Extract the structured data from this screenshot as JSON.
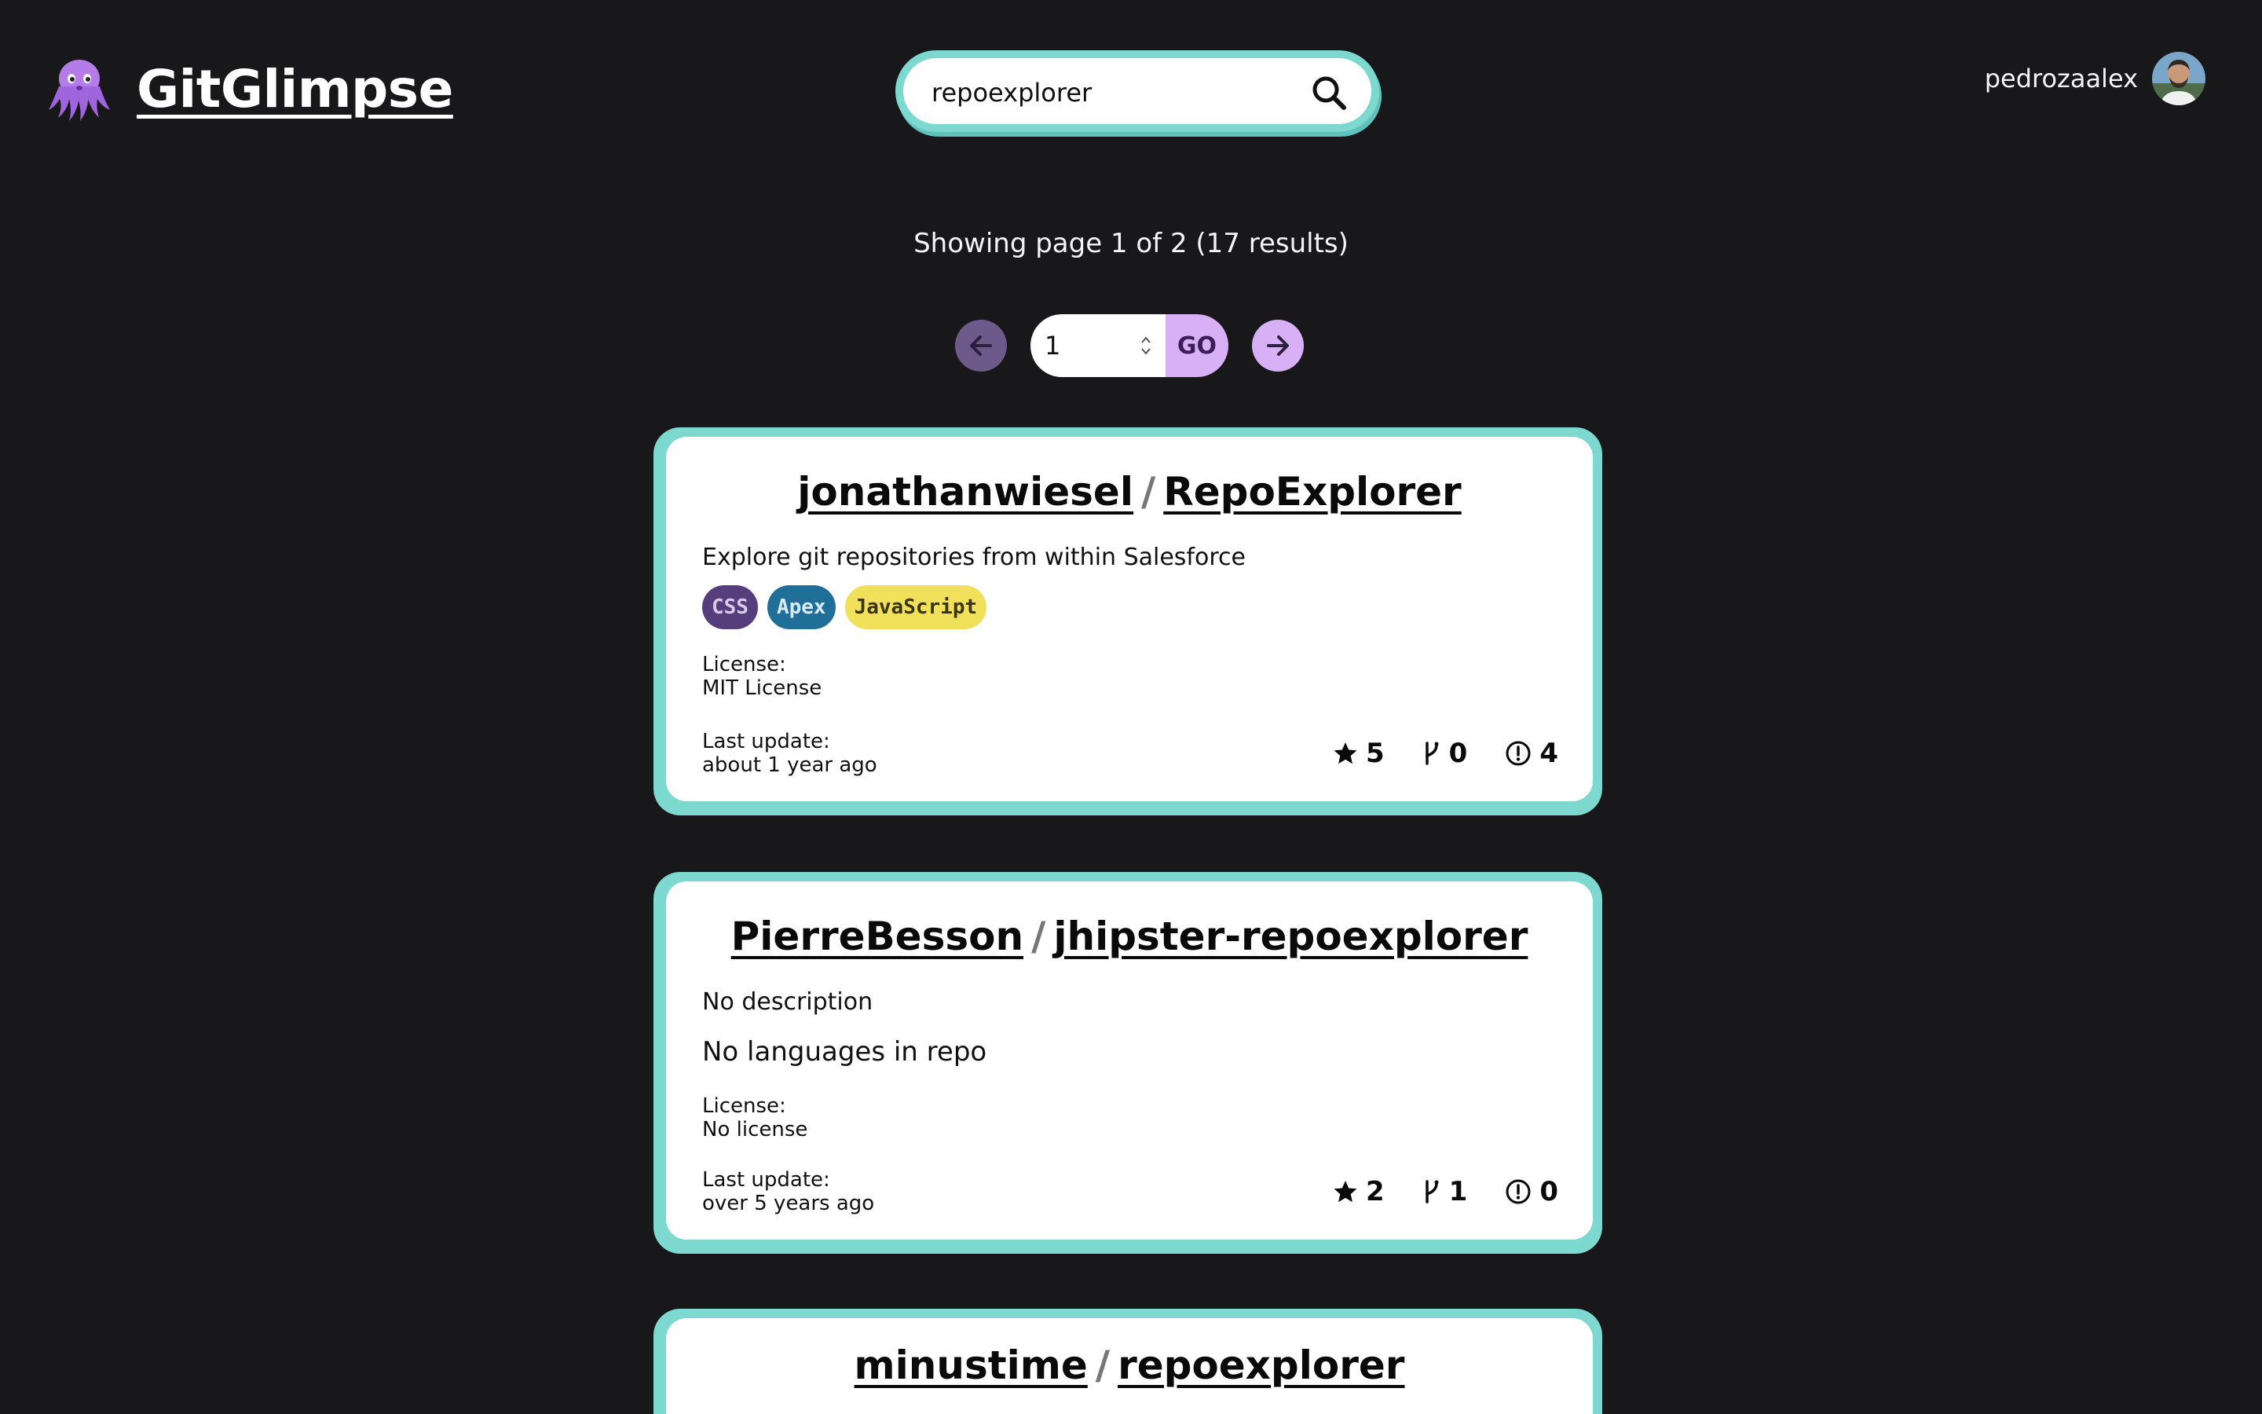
{
  "app": {
    "name": "GitGlimpse",
    "logo_icon": "octopus-icon"
  },
  "search": {
    "value": "repoexplorer",
    "button_icon": "search-icon"
  },
  "user": {
    "username": "pedrozaalex",
    "avatar_icon": "avatar-photo"
  },
  "results": {
    "summary": "Showing page 1 of 2 (17 results)"
  },
  "pagination": {
    "page_value": "1",
    "go_label": "GO",
    "prev_icon": "arrow-left-icon",
    "next_icon": "arrow-right-icon",
    "prev_enabled": false,
    "next_enabled": true
  },
  "repos": [
    {
      "owner": "jonathanwiesel",
      "separator": "/",
      "name": "RepoExplorer",
      "description": "Explore git repositories from within Salesforce",
      "languages": [
        {
          "name": "CSS",
          "bg": "#563d7c",
          "fg": "#d9cce8"
        },
        {
          "name": "Apex",
          "bg": "#1f6f99",
          "fg": "#d7ecf6"
        },
        {
          "name": "JavaScript",
          "bg": "#f1e05a",
          "fg": "#3a3410"
        }
      ],
      "no_languages_text": "",
      "license_label": "License:",
      "license": "MIT License",
      "last_update_label": "Last update:",
      "last_update": "about 1 year ago",
      "stars": "5",
      "forks": "0",
      "issues": "4"
    },
    {
      "owner": "PierreBesson",
      "separator": "/",
      "name": "jhipster-repoexplorer",
      "description": "No description",
      "languages": [],
      "no_languages_text": "No languages in repo",
      "license_label": "License:",
      "license": "No license",
      "last_update_label": "Last update:",
      "last_update": "over 5 years ago",
      "stars": "2",
      "forks": "1",
      "issues": "0"
    },
    {
      "owner": "minustime",
      "separator": "/",
      "name": "repoexplorer"
    }
  ],
  "colors": {
    "background": "#18181b",
    "card_border": "#7dd8d0",
    "accent_purple": "#d8b0f6",
    "disabled_purple": "#6e5a8a"
  }
}
